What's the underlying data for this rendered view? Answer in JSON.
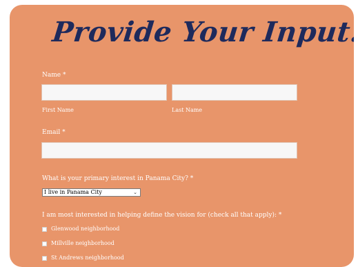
{
  "form": {
    "title": "Provide Your Input!",
    "name_label": "Name *",
    "first_name_label": "First Name",
    "last_name_label": "Last Name",
    "first_name_value": "",
    "last_name_value": "",
    "email_label": "Email *",
    "email_value": "",
    "interest_label": "What is your primary interest in Panama City? *",
    "interest_selected": "I live in Panama City",
    "vision_label": "I am most interested in helping define the vision for (check all that apply): *",
    "checkboxes": [
      {
        "label": "Glenwood neighborhood",
        "checked": false
      },
      {
        "label": "Millville neighborhood",
        "checked": false
      },
      {
        "label": "St Andrews neighborhood",
        "checked": false
      }
    ]
  },
  "colors": {
    "card_bg": "#e8956a",
    "title": "#1e2a5c",
    "text": "#ffffff"
  }
}
